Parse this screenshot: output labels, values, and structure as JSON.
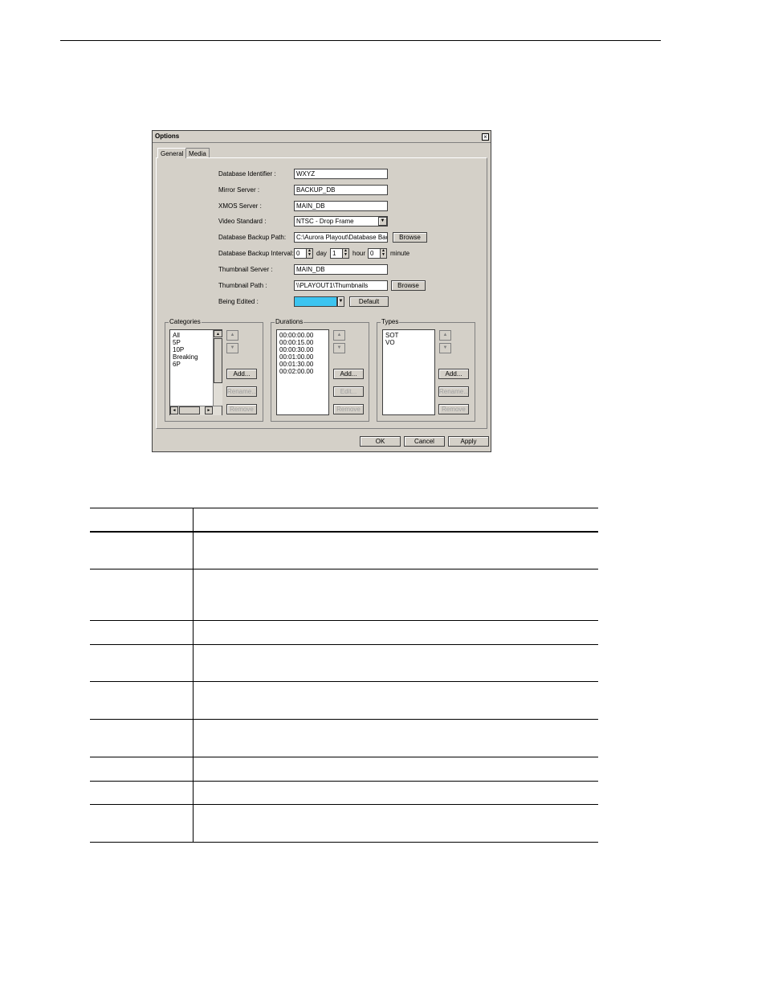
{
  "dialog": {
    "title": "Options",
    "close_label": "×",
    "tabs": [
      {
        "label": "General"
      },
      {
        "label": "Media"
      }
    ],
    "fields": {
      "database_identifier": {
        "label": "Database Identifier :",
        "value": "WXYZ"
      },
      "mirror_server": {
        "label": "Mirror Server :",
        "value": "BACKUP_DB"
      },
      "xmos_server": {
        "label": "XMOS Server :",
        "value": "MAIN_DB"
      },
      "video_standard": {
        "label": "Video Standard :",
        "value": "NTSC - Drop Frame"
      },
      "backup_path": {
        "label": "Database Backup Path:",
        "value": "C:\\Aurora Playout\\Database Backu",
        "browse": "Browse"
      },
      "backup_interval": {
        "label": "Database Backup Interval:",
        "day_value": "0",
        "day_unit": "day",
        "hour_value": "1",
        "hour_unit": "hour",
        "minute_value": "0",
        "minute_unit": "minute"
      },
      "thumbnail_server": {
        "label": "Thumbnail Server :",
        "value": "MAIN_DB"
      },
      "thumbnail_path": {
        "label": "Thumbnail Path :",
        "value": "\\\\PLAYOUT1\\Thumbnails",
        "browse": "Browse"
      },
      "being_edited": {
        "label": "Being Edited :",
        "default_label": "Default",
        "color": "#3cc4f0"
      }
    },
    "categories": {
      "title": "Categories",
      "items": [
        "All",
        "5P",
        "10P",
        "Breaking",
        "6P"
      ],
      "add": "Add...",
      "rename": "Rename...",
      "remove": "Remove"
    },
    "durations": {
      "title": "Durations",
      "items": [
        "00:00:00.00",
        "00:00:15.00",
        "00:00:30.00",
        "00:01:00.00",
        "00:01:30.00",
        "00:02:00.00"
      ],
      "add": "Add...",
      "edit": "Edit...",
      "remove": "Remove"
    },
    "types": {
      "title": "Types",
      "items": [
        "SOT",
        "VO"
      ],
      "add": "Add...",
      "rename": "Rename...",
      "remove": "Remove"
    },
    "buttons": {
      "ok": "OK",
      "cancel": "Cancel",
      "apply": "Apply"
    }
  }
}
